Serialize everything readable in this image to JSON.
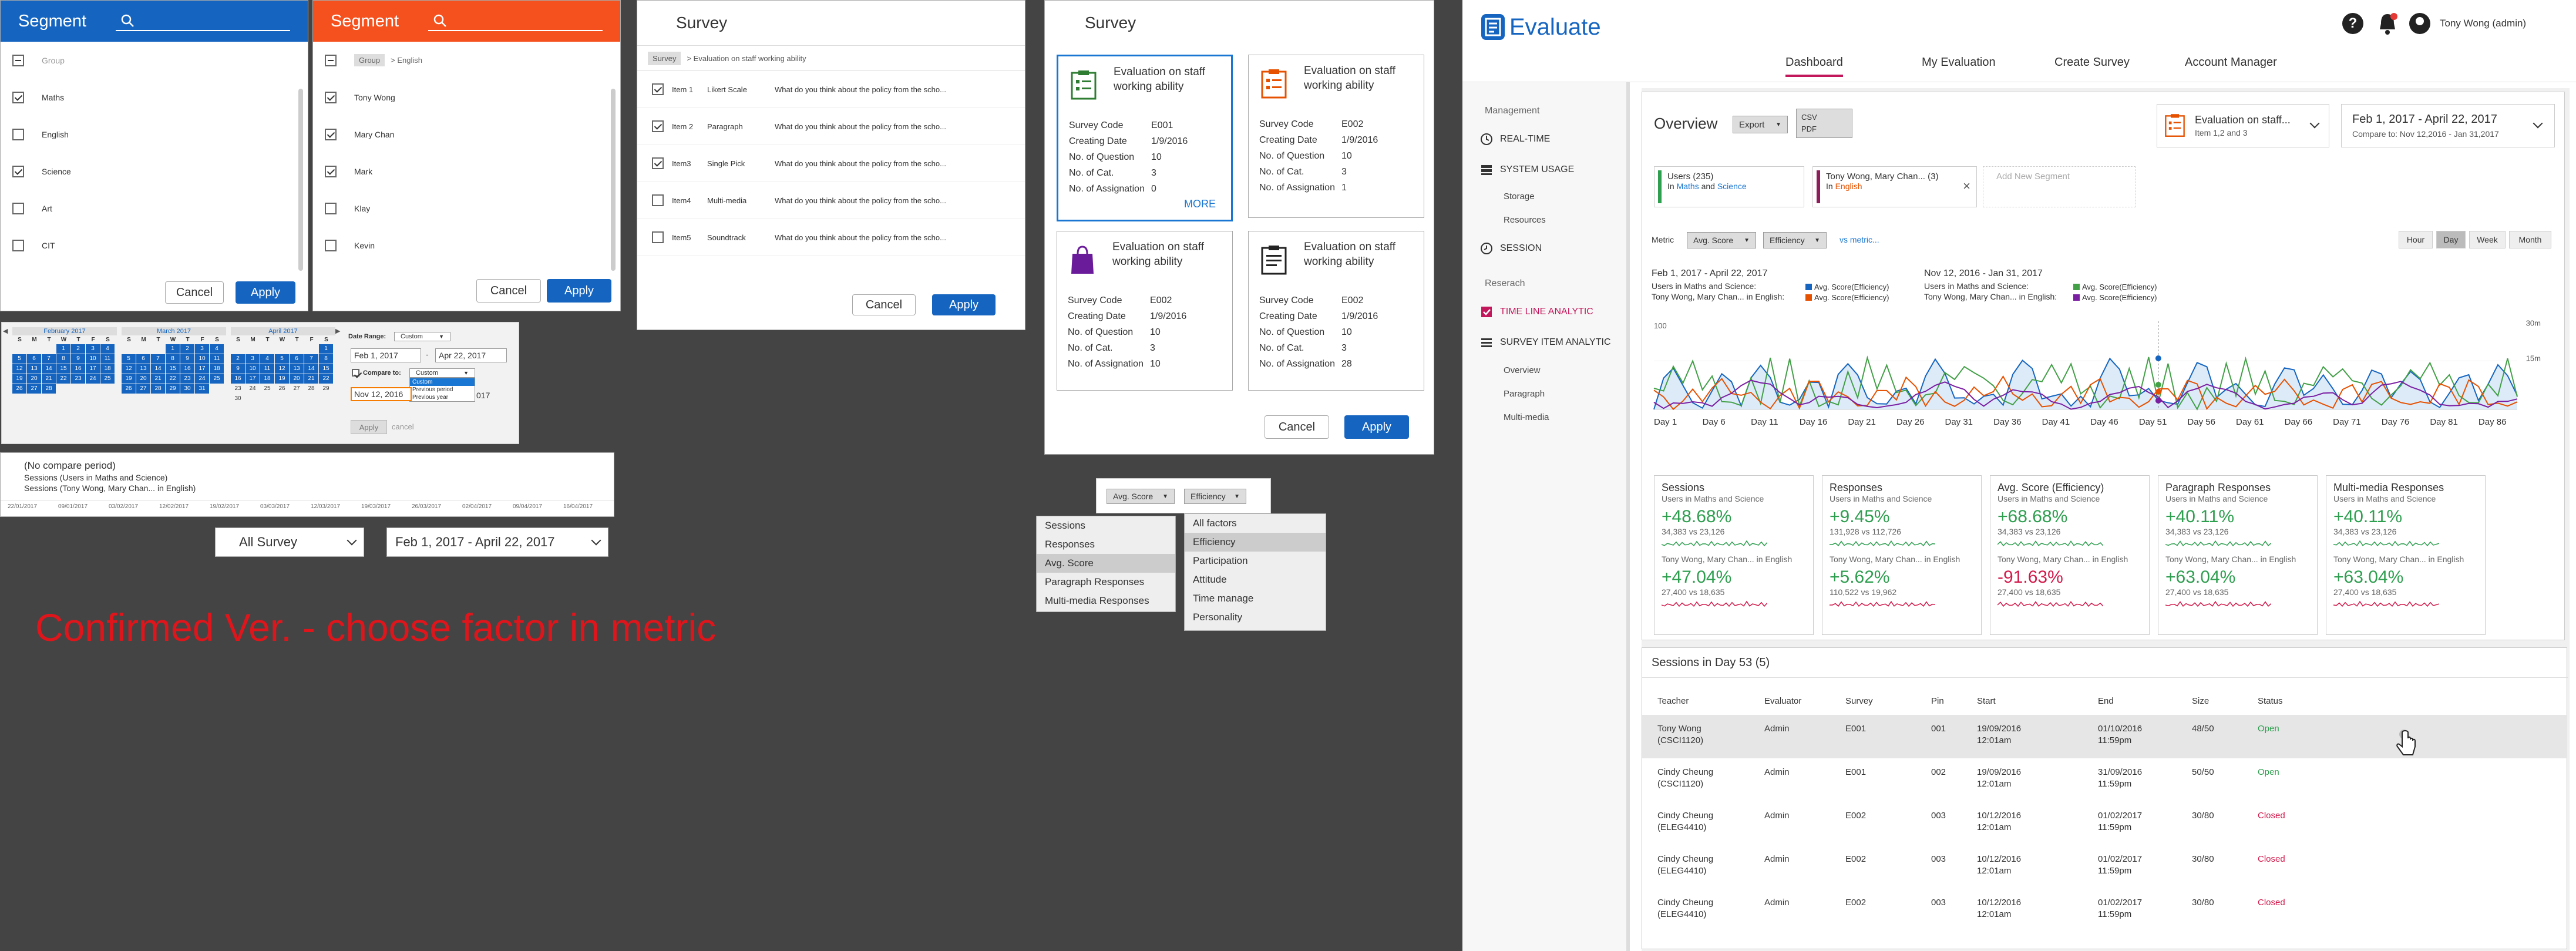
{
  "segment_blue": {
    "title": "Segment",
    "group_label": "Group",
    "items": [
      {
        "label": "Maths",
        "checked": true
      },
      {
        "label": "English",
        "checked": false
      },
      {
        "label": "Science",
        "checked": true
      },
      {
        "label": "Art",
        "checked": false
      },
      {
        "label": "CIT",
        "checked": false
      }
    ],
    "cancel": "Cancel",
    "apply": "Apply",
    "color": "#1565c0"
  },
  "segment_orange": {
    "title": "Segment",
    "breadcrumb_group": "Group",
    "breadcrumb_sep": "> English",
    "items": [
      {
        "label": "Tony Wong",
        "checked": true
      },
      {
        "label": "Mary Chan",
        "checked": true
      },
      {
        "label": "Mark",
        "checked": true
      },
      {
        "label": "Klay",
        "checked": false
      },
      {
        "label": "Kevin",
        "checked": false
      }
    ],
    "cancel": "Cancel",
    "apply": "Apply",
    "color": "#f4511e"
  },
  "survey_items": {
    "title": "Survey",
    "breadcrumb_root": "Survey",
    "breadcrumb_rest": "> Evaluation on staff working ability",
    "rows": [
      {
        "item": "Item 1",
        "type": "Likert Scale",
        "q": "What do you think about the policy from the scho...",
        "checked": true
      },
      {
        "item": "Item 2",
        "type": "Paragraph",
        "q": "What do you think about the policy from the scho...",
        "checked": true
      },
      {
        "item": "Item3",
        "type": "Single Pick",
        "q": "What do you think about the policy from the scho...",
        "checked": true
      },
      {
        "item": "Item4",
        "type": "Multi-media",
        "q": "What do you think about the policy from the scho...",
        "checked": false
      },
      {
        "item": "Item5",
        "type": "Soundtrack",
        "q": "What do you think about the policy from the scho...",
        "checked": false
      }
    ],
    "cancel": "Cancel",
    "apply": "Apply"
  },
  "survey_cards": {
    "title": "Survey",
    "labels": {
      "code": "Survey Code",
      "date": "Creating Date",
      "nq": "No. of Question",
      "ncat": "No. of Cat.",
      "nasg": "No. of Assignation"
    },
    "cards": [
      {
        "title": "Evaluation on staff working ability",
        "code": "E001",
        "date": "1/9/2016",
        "nq": "10",
        "ncat": "3",
        "nasg": "0",
        "more": "MORE",
        "icon": "clipboard-green-icon"
      },
      {
        "title": "Evaluation on staff working ability",
        "code": "E002",
        "date": "1/9/2016",
        "nq": "10",
        "ncat": "3",
        "nasg": "1",
        "icon": "clipboard-orange-icon"
      },
      {
        "title": "Evaluation on staff working ability",
        "code": "E002",
        "date": "1/9/2016",
        "nq": "10",
        "ncat": "3",
        "nasg": "10",
        "icon": "bag-purple-icon"
      },
      {
        "title": "Evaluation on staff working ability",
        "code": "E002",
        "date": "1/9/2016",
        "nq": "10",
        "ncat": "3",
        "nasg": "28",
        "icon": "clipboard-black-icon"
      }
    ],
    "cancel": "Cancel",
    "apply": "Apply"
  },
  "calendar": {
    "months": [
      "February 2017",
      "March 2017",
      "April 2017"
    ],
    "dow": [
      "S",
      "M",
      "T",
      "W",
      "T",
      "F",
      "S"
    ],
    "date_range_label": "Date Range:",
    "date_range_value": "Custom",
    "from": "Feb 1, 2017",
    "dash": "-",
    "to": "Apr 22, 2017",
    "compare_label": "Compare to:",
    "compare_value": "Custom",
    "compare_options": [
      "Custom",
      "Previous period",
      "Previous year"
    ],
    "compare_from": "Nov 12, 2016",
    "compare_to_tail": "017",
    "apply": "Apply",
    "cancel": "cancel"
  },
  "no_compare": {
    "line1": "(No compare period)",
    "line2": "Sessions (Users in Maths and Science)",
    "line3": "Sessions (Tony Wong, Mary Chan... in English)",
    "ticks": [
      "22/01/2017",
      "09/01/2017",
      "03/02/2017",
      "12/02/2017",
      "19/02/2017",
      "03/03/2017",
      "12/03/2017",
      "19/03/2017",
      "26/03/2017",
      "02/04/2017",
      "09/04/2017",
      "16/04/2017"
    ]
  },
  "bottom_dropdowns": {
    "survey": "All Survey",
    "date": "Feb 1, 2017 - April 22, 2017"
  },
  "metric_picker": {
    "avg_score": "Avg. Score",
    "efficiency": "Efficiency",
    "left_menu": [
      "Sessions",
      "Responses",
      "Avg. Score",
      "Paragraph Responses",
      "Multi-media Responses"
    ],
    "right_menu": [
      "All factors",
      "Efficiency",
      "Participation",
      "Attitude",
      "Time manage",
      "Personality"
    ]
  },
  "confirmed_text": "Confirmed Ver. - choose factor in metric",
  "dashboard": {
    "app_name": "Evaluate",
    "user": "Tony Wong (admin)",
    "tabs": [
      "Dashboard",
      "My Evaluation",
      "Create Survey",
      "Account Manager"
    ],
    "side": {
      "management": "Management",
      "realtime": "REAL-TIME",
      "system_usage": "SYSTEM USAGE",
      "storage": "Storage",
      "resources": "Resources",
      "session": "SESSION",
      "research": "Reserach",
      "timeline": "TIME LINE ANALYTIC",
      "survey_item": "SURVEY ITEM ANALYTIC",
      "overview": "Overview",
      "paragraph": "Paragraph",
      "multimedia": "Multi-media"
    },
    "overview": "Overview",
    "export": "Export",
    "csv": "CSV",
    "pdf": "PDF",
    "survey_dd_title": "Evaluation on staff...",
    "survey_dd_sub": "Item 1,2 and 3",
    "date_dd": "Feb 1, 2017 - April 22, 2017",
    "compare_dd": "Compare to: Nov 12,2016 - Jan 31,2017",
    "chip1_title": "Users (235)",
    "chip1_sub_pre": "In ",
    "chip1_sub_a": "Maths",
    "chip1_sub_mid": " and ",
    "chip1_sub_b": "Science",
    "chip2_title": "Tony Wong, Mary Chan... (3)",
    "chip2_sub_pre": "In ",
    "chip2_sub_a": "English",
    "add_segment": "Add New Segment",
    "metric_label": "Metric",
    "metric_dd1": "Avg. Score",
    "metric_dd2": "Efficiency",
    "vs_metric": "vs metric...",
    "gran": [
      "Hour",
      "Day",
      "Week",
      "Month"
    ],
    "legend_left_date": "Feb 1, 2017 - April 22, 2017",
    "legend_right_date": "Nov 12, 2016 - Jan 31, 2017",
    "legend_row1": "Users in Maths and Science:",
    "legend_row2": "Tony Wong, Mary Chan... in English:",
    "legend_series": "Avg. Score(Efficiency)",
    "y_labels": [
      "100",
      "30m",
      "15m"
    ],
    "x_labels": [
      "Day 1",
      "Day 6",
      "Day 11",
      "Day 16",
      "Day 21",
      "Day 26",
      "Day 31",
      "Day 36",
      "Day 41",
      "Day 46",
      "Day 51",
      "Day 56",
      "Day 61",
      "Day 66",
      "Day 71",
      "Day 76",
      "Day 81",
      "Day 86"
    ],
    "metrics": [
      {
        "title": "Sessions",
        "sub": "Users in Maths and Science",
        "v1": "+48.68%",
        "c1": "34,383 vs 23,126",
        "sub2": "Tony Wong, Mary Chan... in English",
        "v2": "+47.04%",
        "c2": "27,400 vs 18,635",
        "v1neg": false,
        "v2neg": false
      },
      {
        "title": "Responses",
        "sub": "Users in Maths and Science",
        "v1": "+9.45%",
        "c1": "131,928 vs 112,726",
        "sub2": "Tony Wong, Mary Chan... in English",
        "v2": "+5.62%",
        "c2": "110,522 vs 19,962",
        "v1neg": false,
        "v2neg": false
      },
      {
        "title": "Avg. Score (Efficiency)",
        "sub": "Users in Maths and Science",
        "v1": "+68.68%",
        "c1": "34,383 vs 23,126",
        "sub2": "Tony Wong, Mary Chan... in English",
        "v2": "-91.63%",
        "c2": "27,400 vs 18,635",
        "v1neg": false,
        "v2neg": true
      },
      {
        "title": "Paragraph Responses",
        "sub": "Users in Maths and Science",
        "v1": "+40.11%",
        "c1": "34,383 vs 23,126",
        "sub2": "Tony Wong, Mary Chan... in English",
        "v2": "+63.04%",
        "c2": "27,400 vs 18,635",
        "v1neg": false,
        "v2neg": false
      },
      {
        "title": "Multi-media Responses",
        "sub": "Users in Maths and Science",
        "v1": "+40.11%",
        "c1": "34,383 vs 23,126",
        "sub2": "Tony Wong, Mary Chan... in English",
        "v2": "+63.04%",
        "c2": "27,400 vs 18,635",
        "v1neg": false,
        "v2neg": false
      }
    ],
    "sessions_title": "Sessions in Day 53 (5)",
    "columns": [
      "Teacher",
      "Evaluator",
      "Survey",
      "Pin",
      "Start",
      "End",
      "Size",
      "Status"
    ],
    "rows": [
      {
        "t1": "Tony Wong",
        "t2": "(CSCI1120)",
        "ev": "Admin",
        "sv": "E001",
        "pin": "001",
        "s1": "19/09/2016",
        "s2": "12:01am",
        "e1": "01/10/2016",
        "e2": "11:59pm",
        "size": "48/50",
        "status": "Open"
      },
      {
        "t1": "Cindy Cheung",
        "t2": "(CSCI1120)",
        "ev": "Admin",
        "sv": "E001",
        "pin": "002",
        "s1": "19/09/2016",
        "s2": "12:01am",
        "e1": "31/09/2016",
        "e2": "11:59pm",
        "size": "50/50",
        "status": "Open"
      },
      {
        "t1": "Cindy Cheung",
        "t2": "(ELEG4410)",
        "ev": "Admin",
        "sv": "E002",
        "pin": "003",
        "s1": "10/12/2016",
        "s2": "12:01am",
        "e1": "01/02/2017",
        "e2": "11:59pm",
        "size": "30/80",
        "status": "Closed"
      },
      {
        "t1": "Cindy Cheung",
        "t2": "(ELEG4410)",
        "ev": "Admin",
        "sv": "E002",
        "pin": "003",
        "s1": "10/12/2016",
        "s2": "12:01am",
        "e1": "01/02/2017",
        "e2": "11:59pm",
        "size": "30/80",
        "status": "Closed"
      },
      {
        "t1": "Cindy Cheung",
        "t2": "(ELEG4410)",
        "ev": "Admin",
        "sv": "E002",
        "pin": "003",
        "s1": "10/12/2016",
        "s2": "12:01am",
        "e1": "01/02/2017",
        "e2": "11:59pm",
        "size": "30/80",
        "status": "Closed"
      }
    ]
  }
}
